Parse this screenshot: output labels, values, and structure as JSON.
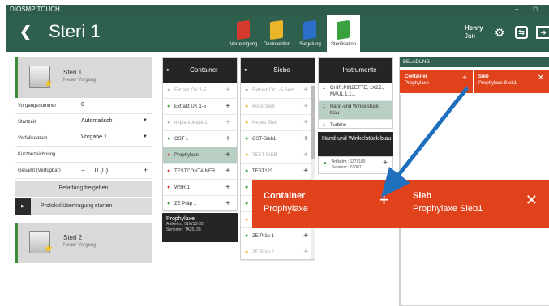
{
  "app": {
    "window_title": "DIOSMP TOUCH",
    "title": "Steri 1"
  },
  "steps": [
    {
      "label": "Vorreinigung",
      "color": "#d63a2f"
    },
    {
      "label": "Desinfektion",
      "color": "#e9b62a"
    },
    {
      "label": "Siegelung",
      "color": "#2b6fc8"
    },
    {
      "label": "Sterilisation",
      "color": "#3aa040"
    }
  ],
  "user": {
    "first": "Henry",
    "last": "Jan"
  },
  "left": {
    "card1": {
      "name": "Steri 1",
      "sub": "Neuer Vorgang"
    },
    "fields": {
      "vorgang_k": "Vorgangsnummer",
      "vorgang_v": "0",
      "start_k": "Startzeit",
      "start_v": "Automatisch",
      "verfall_k": "Verfallsdatum",
      "verfall_v": "Vorgabe 1",
      "kurz_k": "Kurzbezeichnung",
      "gesamt_k": "Gesamt (Verfügbar)",
      "gesamt_minus": "−",
      "gesamt_v": "0 (0)",
      "gesamt_plus": "+"
    },
    "btn_beladung": "Beladung freigeben",
    "btn_proto": "Protokollübertragung starten",
    "card2": {
      "name": "Steri 2",
      "sub": "Neuer Vorgang"
    }
  },
  "container": {
    "header": "Container",
    "items": [
      {
        "label": "Extrakt OK 1-5",
        "dim": true,
        "bullet": "#aaa"
      },
      {
        "label": "Extrakt UK 1-5",
        "dim": false,
        "bullet": "#3aa040"
      },
      {
        "label": "Implantologie 1",
        "dim": true,
        "bullet": "#aaa"
      },
      {
        "label": "OST 1",
        "dim": false,
        "bullet": "#3aa040"
      },
      {
        "label": "Prophylaxe",
        "dim": false,
        "bullet": "#d63a2f",
        "selected": true
      },
      {
        "label": "TESTCONTAINER",
        "dim": false,
        "bullet": "#d63a2f"
      },
      {
        "label": "WSR 1",
        "dim": false,
        "bullet": "#d63a2f"
      },
      {
        "label": "ZE Präp 1",
        "dim": false,
        "bullet": "#3aa040"
      }
    ],
    "info": {
      "title": "Prophylaxe",
      "l1": "Artikelnr.: 01WS2-02",
      "l2": "Seriennr.: TA25133"
    }
  },
  "siebe": {
    "header": "Siebe",
    "items": [
      {
        "label": "Extrakt OK1-5-Sieb",
        "dim": true,
        "bullet": "#aaa"
      },
      {
        "label": "Kons-Sieb",
        "dim": true,
        "bullet": "#e9b62a"
      },
      {
        "label": "Neues Sieb",
        "dim": true,
        "bullet": "#e9b62a"
      },
      {
        "label": "OST-Sieb1",
        "dim": false,
        "bullet": "#3aa040"
      },
      {
        "label": "TEST SIEB",
        "dim": true,
        "bullet": "#e9b62a"
      },
      {
        "label": "TEST123",
        "dim": false,
        "bullet": "#3aa040"
      },
      {
        "label": "",
        "dim": false,
        "bullet": "#3aa040"
      },
      {
        "label": "",
        "dim": false,
        "bullet": "#3aa040"
      },
      {
        "label": "",
        "dim": true,
        "bullet": "#e9b62a"
      },
      {
        "label": "ZE Präp 1",
        "dim": false,
        "bullet": "#3aa040"
      },
      {
        "label": "ZE Präp 2",
        "dim": true,
        "bullet": "#e9b62a"
      }
    ]
  },
  "instrumente": {
    "header": "Instrumente",
    "items": [
      {
        "qty": "1",
        "label": "CHIR.PINZETTE, 1X2Z., MAUL 1,1..."
      },
      {
        "qty": "1",
        "label": "Hand-und Winkelstück blau",
        "selected": true
      },
      {
        "qty": "1",
        "label": "Turbine"
      }
    ],
    "detail": {
      "title": "Hand-und Winkelstück blau",
      "l1": "Artikelnr.: 6376185",
      "l2": "Seriennr.: 01007",
      "plus": "+"
    }
  },
  "beladung": {
    "header": "BELADUNG",
    "container_k": "Container",
    "container_v": "Prophylaxe",
    "container_plus": "+",
    "sieb_k": "Sieb",
    "sieb_v": "Prophylaxe Sieb1",
    "sieb_close": "✕"
  },
  "zoom": {
    "container_k": "Container",
    "container_v": "Prophylaxe",
    "plus": "+",
    "sieb_k": "Sieb",
    "sieb_v": "Prophylaxe Sieb1",
    "close": "✕"
  },
  "colors": {
    "header": "#2f5f4d",
    "accent": "#e0431c",
    "arrow": "#1f6fbf"
  }
}
